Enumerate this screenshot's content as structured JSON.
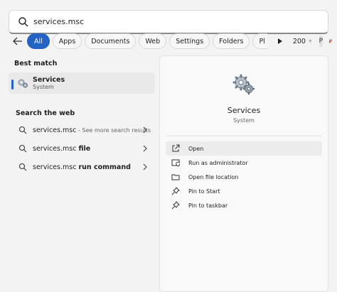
{
  "search": {
    "value": "services.msc"
  },
  "filters": {
    "chips": [
      {
        "label": "All",
        "active": true
      },
      {
        "label": "Apps"
      },
      {
        "label": "Documents"
      },
      {
        "label": "Web"
      },
      {
        "label": "Settings"
      },
      {
        "label": "Folders"
      },
      {
        "label": "Pl"
      }
    ],
    "points": "200",
    "avatar_letter": "P"
  },
  "best_match": {
    "title": "Best match",
    "name": "Services",
    "type": "System"
  },
  "web": {
    "title": "Search the web",
    "items": [
      {
        "bold": "",
        "text": "services.msc",
        "sub": " - See more search results"
      },
      {
        "text": "services.msc ",
        "bold": "file",
        "sub": ""
      },
      {
        "text": "services.msc ",
        "bold": "run command",
        "sub": ""
      }
    ]
  },
  "detail": {
    "name": "Services",
    "type": "System",
    "actions": [
      {
        "label": "Open",
        "icon": "open-external-icon"
      },
      {
        "label": "Run as administrator",
        "icon": "shield-icon"
      },
      {
        "label": "Open file location",
        "icon": "folder-icon"
      },
      {
        "label": "Pin to Start",
        "icon": "pin-icon"
      },
      {
        "label": "Pin to taskbar",
        "icon": "pin-icon"
      }
    ]
  },
  "colors": {
    "accent": "#2462c4"
  }
}
